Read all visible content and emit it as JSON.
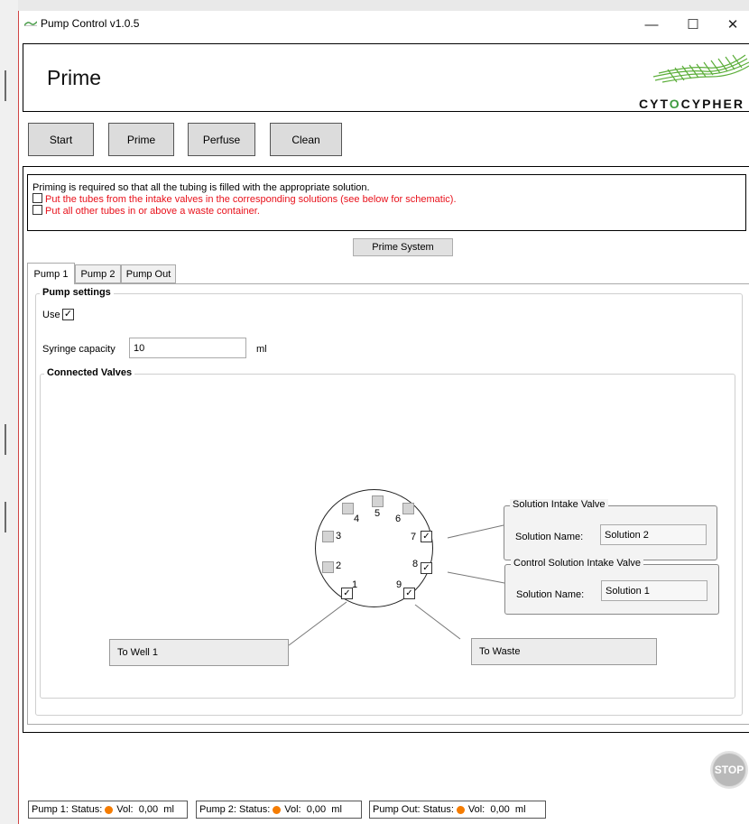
{
  "window": {
    "title": "Pump Control v1.0.5",
    "controls": [
      "—",
      "☐",
      "✕"
    ]
  },
  "header": {
    "page_title": "Prime",
    "logo": {
      "text_pre": "CYT",
      "text_o": "O",
      "text_post": "CYPHER",
      "accent": "#3d9a3f"
    }
  },
  "nav": {
    "start": "Start",
    "prime": "Prime",
    "perfuse": "Perfuse",
    "clean": "Clean"
  },
  "instructions": {
    "intro": "Priming is required so that all the tubing is filled with the appropriate solution.",
    "step1": "Put the tubes from the intake valves in the corresponding solutions (see below for schematic).",
    "step2": "Put all other tubes in or above a waste container.",
    "step_color": "#e8101a"
  },
  "prime_system_label": "Prime System",
  "tabs": {
    "pump1": "Pump 1",
    "pump2": "Pump 2",
    "pump_out": "Pump Out",
    "active": "Pump 1"
  },
  "pump_settings": {
    "legend": "Pump settings",
    "use_label": "Use",
    "use_checked": true,
    "syringe_label": "Syringe capacity",
    "syringe_value": "10",
    "syringe_unit": "ml"
  },
  "connected_valves": {
    "legend": "Connected Valves",
    "ports": {
      "p1": "1",
      "p2": "2",
      "p3": "3",
      "p4": "4",
      "p5": "5",
      "p6": "6",
      "p7": "7",
      "p8": "8",
      "p9": "9"
    },
    "checked_ports": [
      "1",
      "7",
      "8",
      "9"
    ],
    "check_glyph": "✓",
    "solution_intake": {
      "legend": "Solution Intake Valve",
      "name_label": "Solution Name:",
      "name_value": "Solution 2"
    },
    "control_intake": {
      "legend": "Control Solution Intake Valve",
      "name_label": "Solution Name:",
      "name_value": "Solution 1"
    },
    "to_well": "To Well 1",
    "to_waste": "To Waste"
  },
  "stop_label": "STOP",
  "status_bar": {
    "status_color": "#f57c00",
    "pump1": {
      "name": "Pump 1: Status:",
      "vol_label": "Vol:",
      "vol": "0,00",
      "unit": "ml"
    },
    "pump2": {
      "name": "Pump 2: Status:",
      "vol_label": "Vol:",
      "vol": "0,00",
      "unit": "ml"
    },
    "pump_out": {
      "name": "Pump Out: Status:",
      "vol_label": "Vol:",
      "vol": "0,00",
      "unit": "ml"
    }
  }
}
